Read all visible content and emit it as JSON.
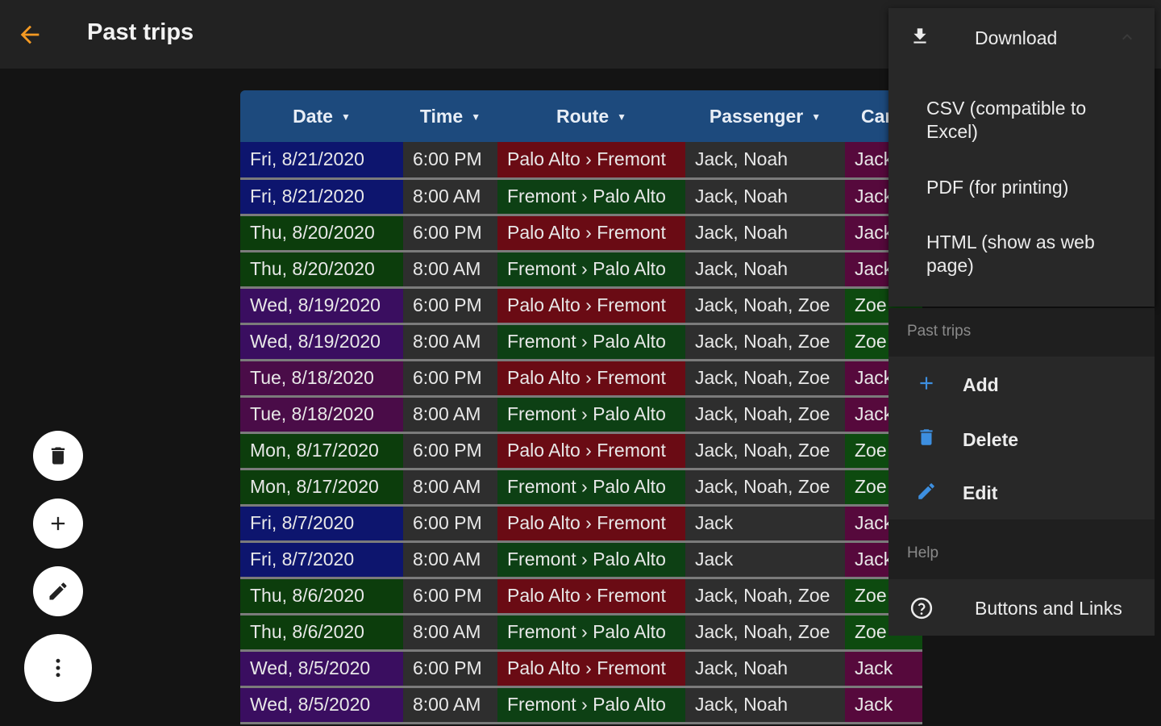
{
  "appbar": {
    "title": "Past trips",
    "accent": "#f59a23"
  },
  "table": {
    "columns": [
      {
        "label": "Date",
        "sortable": true
      },
      {
        "label": "Time",
        "sortable": true
      },
      {
        "label": "Route",
        "sortable": true
      },
      {
        "label": "Passenger",
        "sortable": true
      },
      {
        "label": "Car",
        "sortable": false
      }
    ],
    "day_colors": {
      "Mon": "#0c3d0c",
      "Tue": "#4a0c48",
      "Wed": "#3a0e60",
      "Thu": "#0c3d0c",
      "Fri": "#0d156e"
    },
    "route_colors": {
      "Palo Alto › Fremont": "#6a0b14",
      "Fremont › Palo Alto": "#0d4014"
    },
    "car_colors": {
      "Jack": "#56093c",
      "Zoe": "#0d4a0f"
    },
    "rows": [
      {
        "day": "Fri",
        "date": "Fri, 8/21/2020",
        "time": "6:00 PM",
        "route": "Palo Alto › Fremont",
        "passenger": "Jack, Noah",
        "car": "Jack"
      },
      {
        "day": "Fri",
        "date": "Fri, 8/21/2020",
        "time": "8:00 AM",
        "route": "Fremont › Palo Alto",
        "passenger": "Jack, Noah",
        "car": "Jack"
      },
      {
        "day": "Thu",
        "date": "Thu, 8/20/2020",
        "time": "6:00 PM",
        "route": "Palo Alto › Fremont",
        "passenger": "Jack, Noah",
        "car": "Jack"
      },
      {
        "day": "Thu",
        "date": "Thu, 8/20/2020",
        "time": "8:00 AM",
        "route": "Fremont › Palo Alto",
        "passenger": "Jack, Noah",
        "car": "Jack"
      },
      {
        "day": "Wed",
        "date": "Wed, 8/19/2020",
        "time": "6:00 PM",
        "route": "Palo Alto › Fremont",
        "passenger": "Jack, Noah, Zoe",
        "car": "Zoe"
      },
      {
        "day": "Wed",
        "date": "Wed, 8/19/2020",
        "time": "8:00 AM",
        "route": "Fremont › Palo Alto",
        "passenger": "Jack, Noah, Zoe",
        "car": "Zoe"
      },
      {
        "day": "Tue",
        "date": "Tue, 8/18/2020",
        "time": "6:00 PM",
        "route": "Palo Alto › Fremont",
        "passenger": "Jack, Noah, Zoe",
        "car": "Jack"
      },
      {
        "day": "Tue",
        "date": "Tue, 8/18/2020",
        "time": "8:00 AM",
        "route": "Fremont › Palo Alto",
        "passenger": "Jack, Noah, Zoe",
        "car": "Jack"
      },
      {
        "day": "Mon",
        "date": "Mon, 8/17/2020",
        "time": "6:00 PM",
        "route": "Palo Alto › Fremont",
        "passenger": "Jack, Noah, Zoe",
        "car": "Zoe"
      },
      {
        "day": "Mon",
        "date": "Mon, 8/17/2020",
        "time": "8:00 AM",
        "route": "Fremont › Palo Alto",
        "passenger": "Jack, Noah, Zoe",
        "car": "Zoe"
      },
      {
        "day": "Fri",
        "date": "Fri, 8/7/2020",
        "time": "6:00 PM",
        "route": "Palo Alto › Fremont",
        "passenger": "Jack",
        "car": "Jack"
      },
      {
        "day": "Fri",
        "date": "Fri, 8/7/2020",
        "time": "8:00 AM",
        "route": "Fremont › Palo Alto",
        "passenger": "Jack",
        "car": "Jack"
      },
      {
        "day": "Thu",
        "date": "Thu, 8/6/2020",
        "time": "6:00 PM",
        "route": "Palo Alto › Fremont",
        "passenger": "Jack, Noah, Zoe",
        "car": "Zoe"
      },
      {
        "day": "Thu",
        "date": "Thu, 8/6/2020",
        "time": "8:00 AM",
        "route": "Fremont › Palo Alto",
        "passenger": "Jack, Noah, Zoe",
        "car": "Zoe"
      },
      {
        "day": "Wed",
        "date": "Wed, 8/5/2020",
        "time": "6:00 PM",
        "route": "Palo Alto › Fremont",
        "passenger": "Jack, Noah",
        "car": "Jack"
      },
      {
        "day": "Wed",
        "date": "Wed, 8/5/2020",
        "time": "8:00 AM",
        "route": "Fremont › Palo Alto",
        "passenger": "Jack, Noah",
        "car": "Jack"
      }
    ]
  },
  "fabs": [
    {
      "icon": "trash-icon"
    },
    {
      "icon": "plus-icon"
    },
    {
      "icon": "pencil-icon"
    },
    {
      "icon": "more-vert-icon"
    }
  ],
  "menu": {
    "download": {
      "label": "Download",
      "options": [
        {
          "line1": "CSV (compatible to",
          "line2": "Excel)"
        },
        {
          "line1": "PDF (for printing)",
          "line2": ""
        },
        {
          "line1": "HTML (show as web",
          "line2": "page)"
        }
      ]
    },
    "past_trips": {
      "title": "Past trips",
      "items": [
        {
          "label": "Add",
          "icon": "plus-icon"
        },
        {
          "label": "Delete",
          "icon": "trash-icon"
        },
        {
          "label": "Edit",
          "icon": "pencil-icon"
        }
      ],
      "icon_color": "#3d8fe0"
    },
    "help": {
      "title": "Help",
      "items": [
        {
          "label": "Buttons and Links",
          "icon": "help-circle-icon"
        }
      ]
    }
  }
}
